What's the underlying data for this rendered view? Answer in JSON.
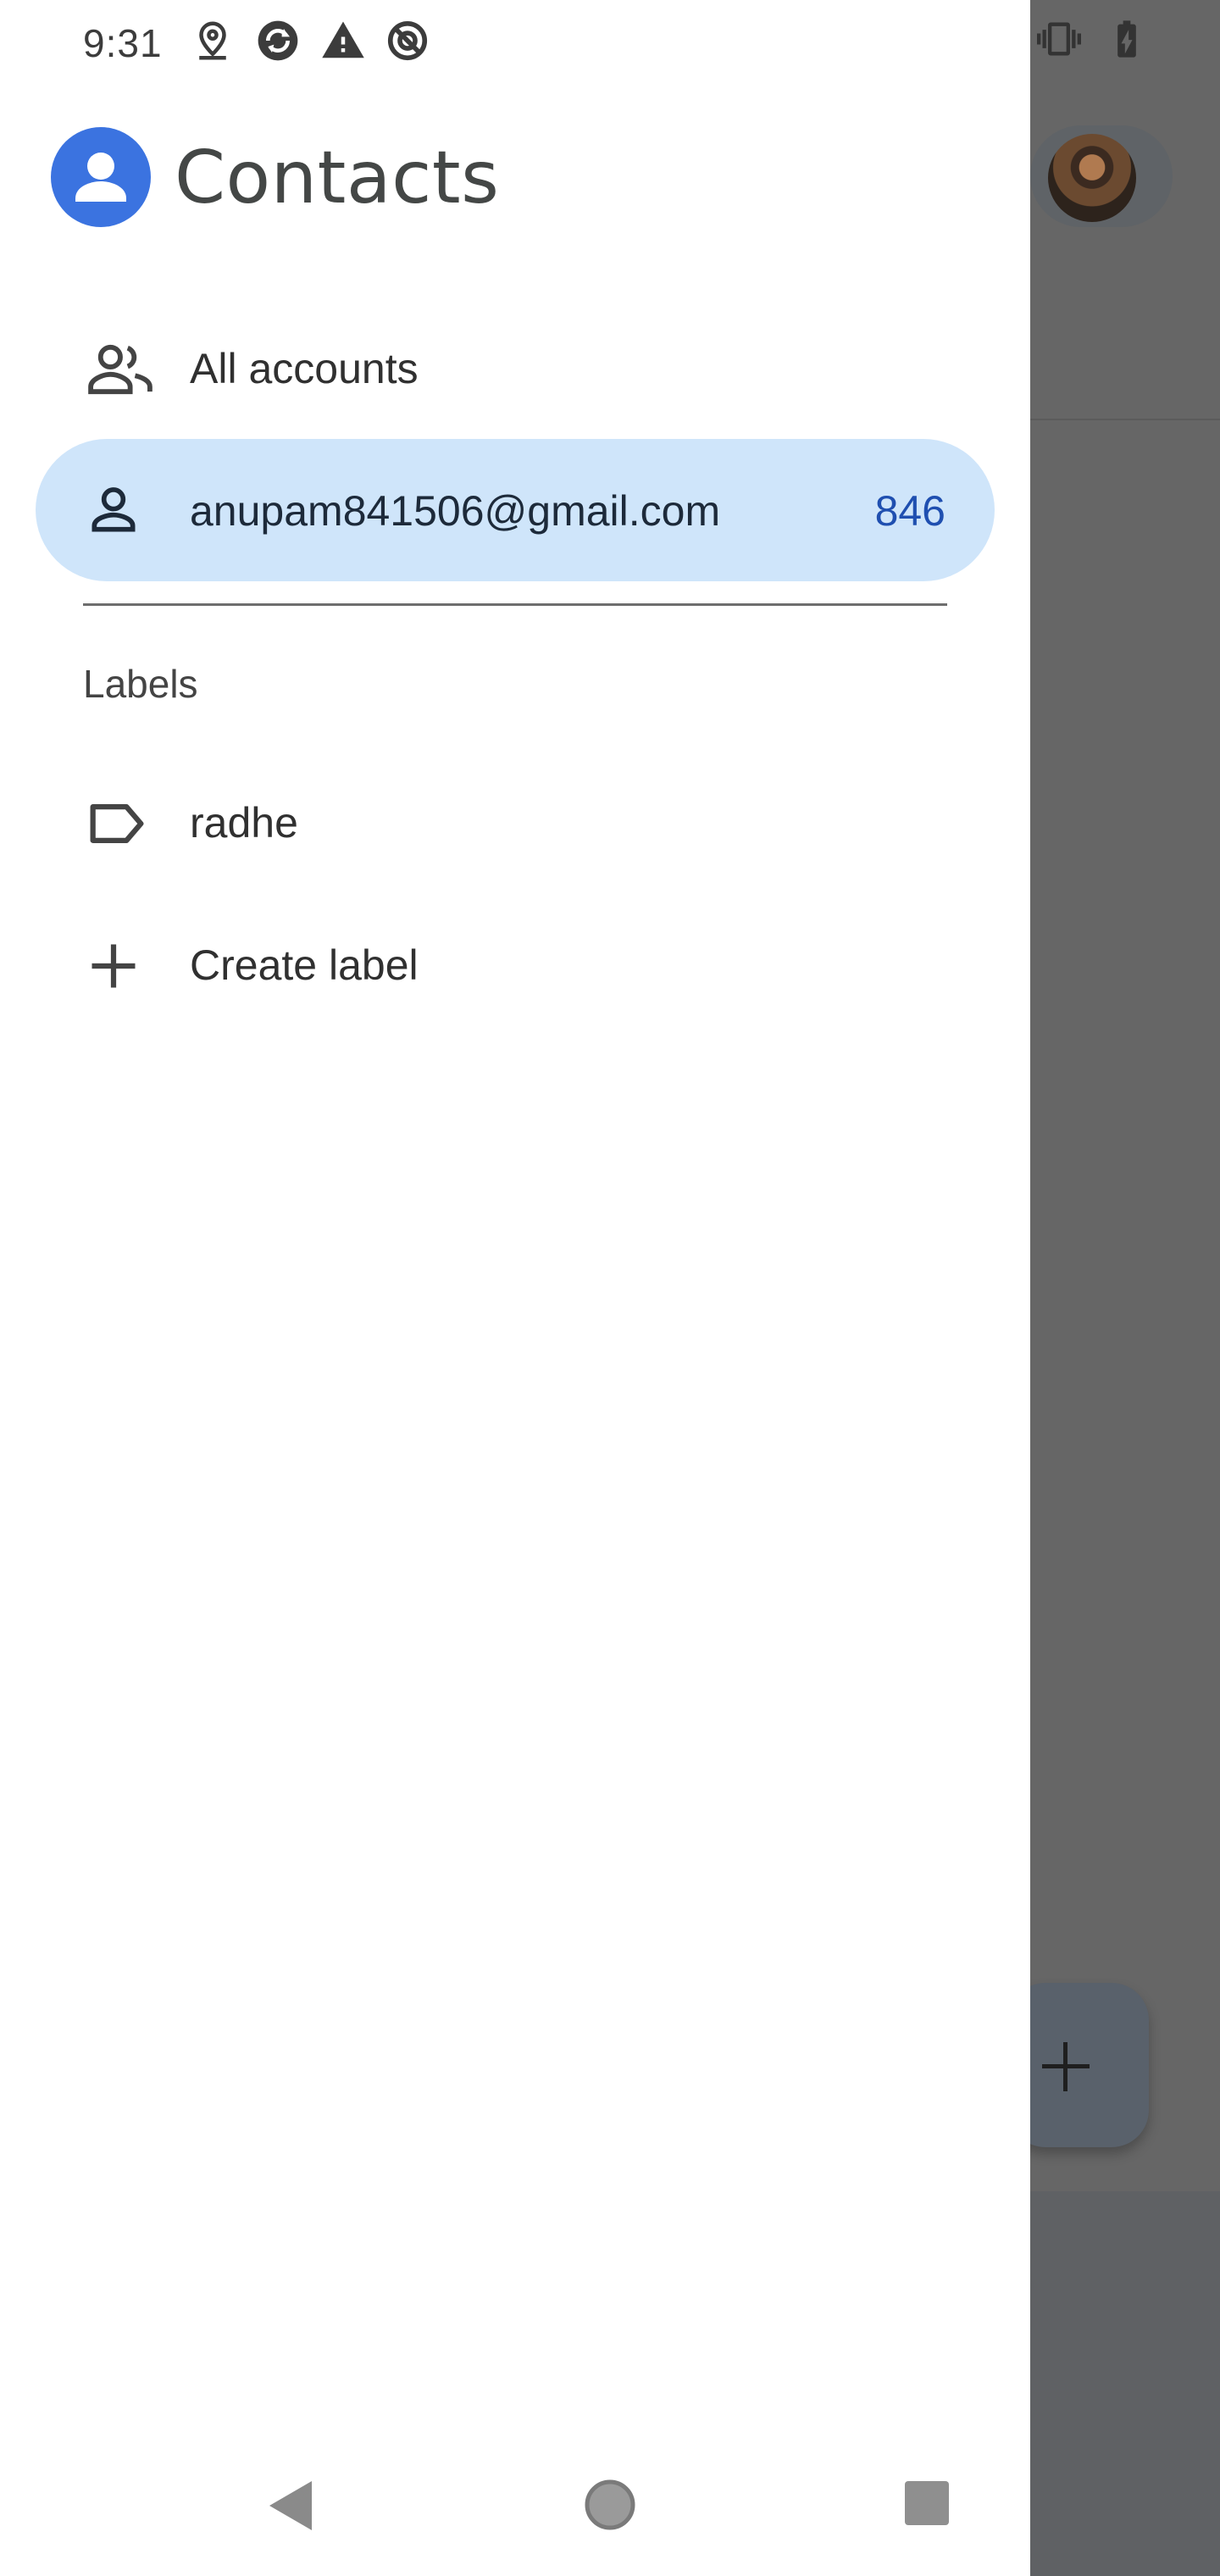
{
  "status_bar": {
    "time": "9:31",
    "left_icons": [
      "location-icon",
      "sync-icon",
      "warning-icon",
      "data-saver-icon"
    ],
    "right_icons": [
      "vibrate-icon",
      "battery-charging-icon"
    ]
  },
  "drawer": {
    "app_title": "Contacts",
    "accounts": [
      {
        "label": "All accounts",
        "icon": "people-icon",
        "active": false
      },
      {
        "label": "anupam841506@gmail.com",
        "icon": "person-icon",
        "count": "846",
        "active": true
      }
    ],
    "labels_section": {
      "header": "Labels",
      "items": [
        {
          "label": "radhe",
          "icon": "label-icon"
        }
      ],
      "create_label": "Create label"
    }
  },
  "colors": {
    "accent": "#3b73e0",
    "active_bg": "#cfe5fa",
    "count": "#1f4fb0",
    "scrim": "#666666"
  },
  "system_nav": [
    "back-icon",
    "home-icon",
    "recents-icon"
  ]
}
